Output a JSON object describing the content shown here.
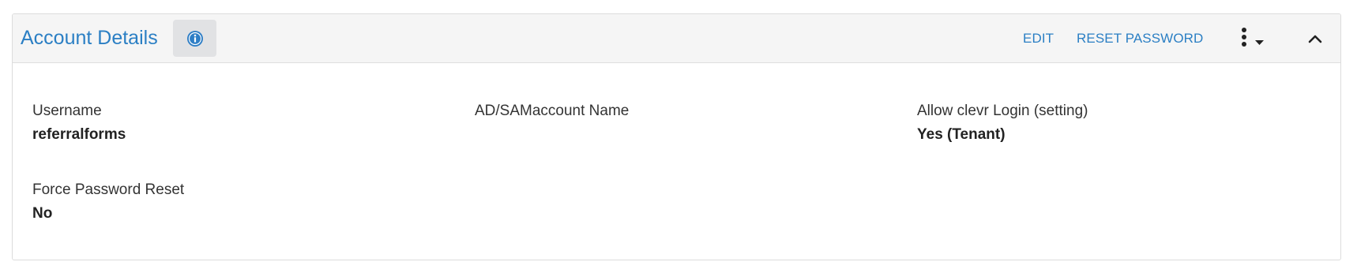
{
  "panel": {
    "title": "Account Details",
    "info_icon": "info-circle-icon",
    "actions": {
      "edit_label": "EDIT",
      "reset_password_label": "RESET PASSWORD",
      "more_icon": "vertical-ellipsis-icon",
      "dropdown_icon": "caret-down-icon",
      "collapse_icon": "chevron-up-icon"
    }
  },
  "fields": {
    "username": {
      "label": "Username",
      "value": "referralforms"
    },
    "ad_samaccount_name": {
      "label": "AD/SAMaccount Name",
      "value": ""
    },
    "allow_clevr_login": {
      "label": "Allow clevr Login (setting)",
      "value": "Yes (Tenant)"
    },
    "force_password_reset": {
      "label": "Force Password Reset",
      "value": "No"
    }
  },
  "colors": {
    "accent": "#2b7fc4",
    "header_bg": "#f5f5f5",
    "info_button_bg": "#e1e2e4",
    "border": "#dcdcdc"
  }
}
